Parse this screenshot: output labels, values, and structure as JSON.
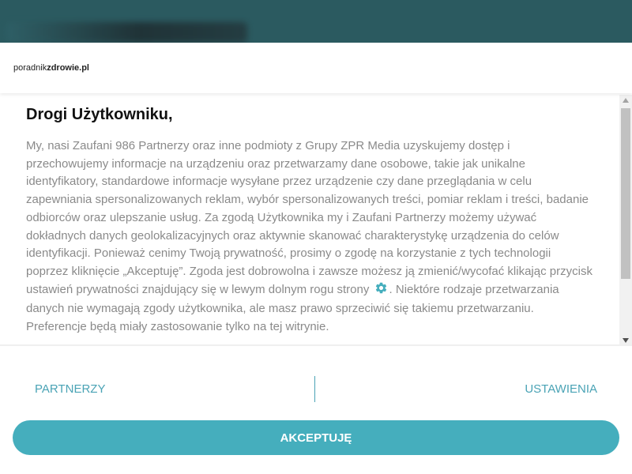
{
  "site": {
    "logo_light": "poradnik",
    "logo_bold": "zdrowie.pl"
  },
  "consent": {
    "heading": "Drogi Użytkowniku,",
    "text_before_icon": "My, nasi Zaufani 986 Partnerzy oraz inne podmioty z Grupy ZPR Media uzyskujemy dostęp i przechowujemy informacje na urządzeniu oraz przetwarzamy dane osobowe, takie jak unikalne identyfikatory, standardowe informacje wysyłane przez urządzenie czy dane przeglądania w celu zapewniania spersonalizowanych reklam, wybór spersonalizowanych treści, pomiar reklam i treści, badanie odbiorców oraz ulepszanie usług. Za zgodą Użytkownika my i Zaufani Partnerzy możemy używać dokładnych danych geolokalizacyjnych oraz aktywnie skanować charakterystykę urządzenia do celów identyfikacji. Ponieważ cenimy Twoją prywatność, prosimy o zgodę na korzystanie z tych technologii poprzez kliknięcie „Akceptuję”. Zgoda jest dobrowolna i zawsze możesz ją zmienić/wycofać klikając przycisk ustawień prywatności znajdujący się w lewym dolnym rogu strony",
    "text_after_icon": ". Niektóre rodzaje przetwarzania danych nie wymagają zgody użytkownika, ale masz prawo sprzeciwić się takiemu przetwarzaniu. Preferencje będą miały zastosowanie tylko na tej witrynie.",
    "settings_icon": "gear-icon"
  },
  "footer": {
    "partners_label": "PARTNERZY",
    "settings_label": "USTAWIENIA",
    "accept_label": "AKCEPTUJĘ"
  },
  "colors": {
    "background_overlay": "#2b5a60",
    "accent": "#45aebd",
    "link": "#4aa3b5",
    "body_text": "#8a8a8a",
    "heading_text": "#111111"
  }
}
